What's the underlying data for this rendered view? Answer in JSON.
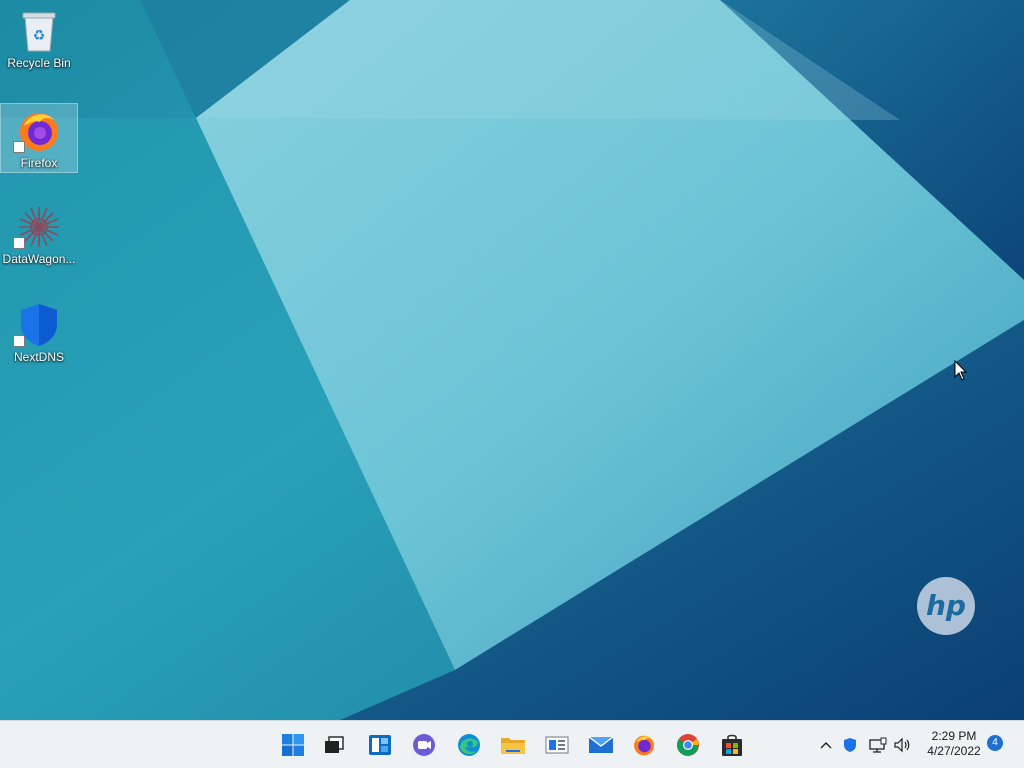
{
  "desktop": {
    "icons": [
      {
        "label": "Recycle Bin",
        "icon": "recycle-bin-icon",
        "shortcut": false,
        "selected": false
      },
      {
        "label": "Firefox",
        "icon": "firefox-icon",
        "shortcut": true,
        "selected": true
      },
      {
        "label": "DataWagon...",
        "icon": "datawagon-icon",
        "shortcut": true,
        "selected": false
      },
      {
        "label": "NextDNS",
        "icon": "nextdns-shield-icon",
        "shortcut": true,
        "selected": false
      }
    ],
    "wallpaper_logo": "hp"
  },
  "taskbar": {
    "pinned": [
      {
        "name": "start",
        "icon": "windows-start-icon"
      },
      {
        "name": "task-view",
        "icon": "task-view-icon"
      },
      {
        "name": "widgets",
        "icon": "widgets-icon"
      },
      {
        "name": "chat",
        "icon": "teams-chat-icon"
      },
      {
        "name": "edge",
        "icon": "edge-icon"
      },
      {
        "name": "file-explorer",
        "icon": "folder-icon"
      },
      {
        "name": "news",
        "icon": "news-icon"
      },
      {
        "name": "mail",
        "icon": "mail-icon"
      },
      {
        "name": "firefox",
        "icon": "firefox-icon"
      },
      {
        "name": "chrome",
        "icon": "chrome-icon"
      },
      {
        "name": "store",
        "icon": "store-icon"
      }
    ],
    "tray": {
      "icons": [
        "chevron-up-icon",
        "shield-icon",
        "network-icon",
        "volume-icon"
      ],
      "time": "2:29 PM",
      "date": "4/27/2022",
      "notification_count": "4"
    }
  },
  "colors": {
    "taskbar_bg": "#eef2f5",
    "accent": "#1f6fd1",
    "wallpaper_base": "#1e8fa8"
  }
}
